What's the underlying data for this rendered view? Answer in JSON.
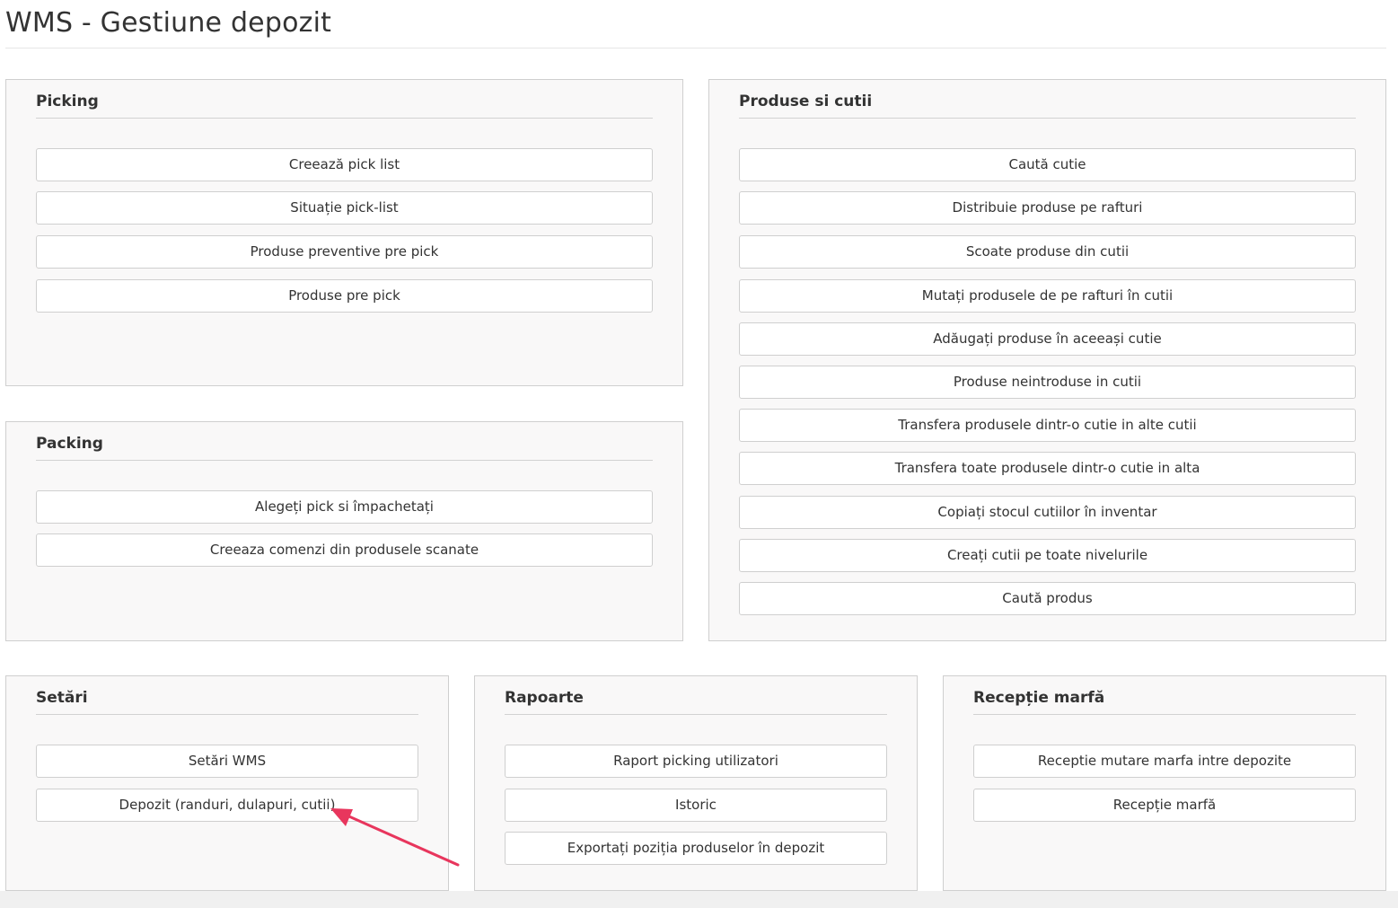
{
  "page": {
    "title": "WMS - Gestiune depozit"
  },
  "picking": {
    "title": "Picking",
    "buttons": [
      "Creează pick list",
      "Situație pick-list",
      "Produse preventive pre pick",
      "Produse pre pick"
    ]
  },
  "packing": {
    "title": "Packing",
    "buttons": [
      "Alegeți pick si împachetați",
      "Creeaza comenzi din produsele scanate"
    ]
  },
  "produse": {
    "title": "Produse si cutii",
    "buttons": [
      "Caută cutie",
      "Distribuie produse pe rafturi",
      "Scoate produse din cutii",
      "Mutați produsele de pe rafturi în cutii",
      "Adăugați produse în aceeași cutie",
      "Produse neintroduse in cutii",
      "Transfera produsele dintr-o cutie in alte cutii",
      "Transfera toate produsele dintr-o cutie in alta",
      "Copiați stocul cutiilor în inventar",
      "Creați cutii pe toate nivelurile",
      "Caută produs"
    ]
  },
  "setari": {
    "title": "Setări",
    "buttons": [
      "Setări WMS",
      "Depozit (randuri, dulapuri, cutii)"
    ]
  },
  "rapoarte": {
    "title": "Rapoarte",
    "buttons": [
      "Raport picking utilizatori",
      "Istoric",
      "Exportați poziția produselor în depozit"
    ]
  },
  "receptie": {
    "title": "Recepție marfă",
    "buttons": [
      "Receptie mutare marfa intre depozite",
      "Recepție marfă"
    ]
  },
  "colors": {
    "annotation_arrow": "#e8365d",
    "panel_bg": "#f9f8f8",
    "border": "#cfcfcf"
  }
}
